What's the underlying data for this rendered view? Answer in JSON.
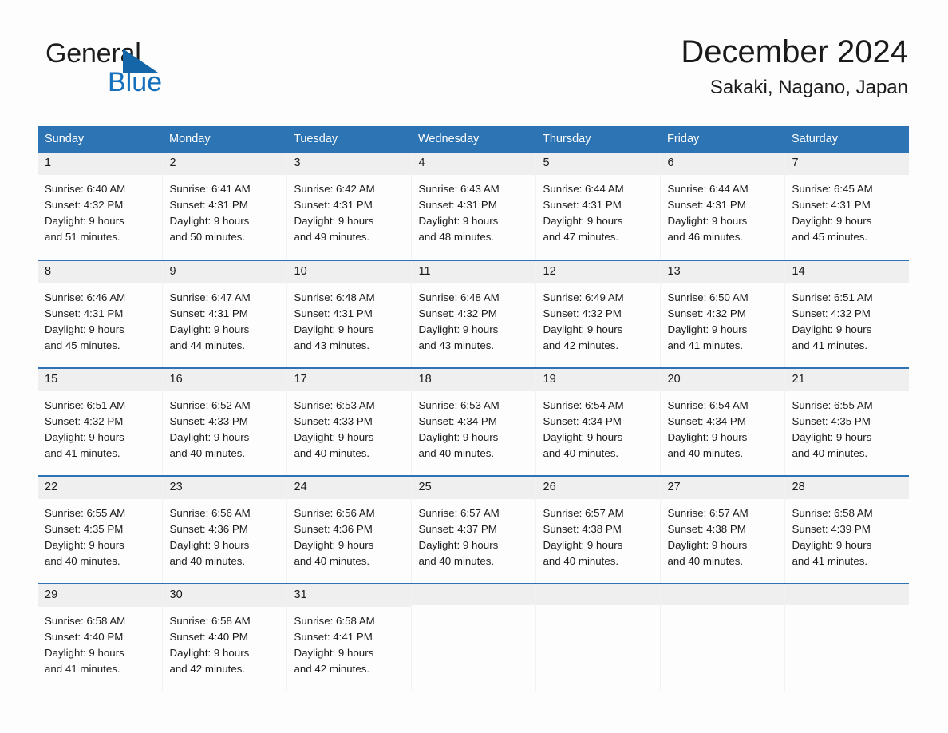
{
  "brand": {
    "name_top": "General",
    "name_bottom": "Blue",
    "triangle_icon": "blue-triangle-logo-mark",
    "accent_color": "#1570bd"
  },
  "header": {
    "title": "December 2024",
    "subtitle": "Sakaki, Nagano, Japan"
  },
  "theme": {
    "header_blue": "#2d74b4",
    "daynum_band": "#efefef",
    "page_background": "#fdfdfd",
    "text_color": "#1a1a1a"
  },
  "calendar": {
    "weekday_headers": [
      "Sunday",
      "Monday",
      "Tuesday",
      "Wednesday",
      "Thursday",
      "Friday",
      "Saturday"
    ],
    "labels": {
      "sunrise": "Sunrise:",
      "sunset": "Sunset:",
      "daylight": "Daylight:"
    },
    "weeks": [
      [
        {
          "day": "1",
          "sunrise": "Sunrise: 6:40 AM",
          "sunset": "Sunset: 4:32 PM",
          "daylight_line1": "Daylight: 9 hours",
          "daylight_line2": "and 51 minutes."
        },
        {
          "day": "2",
          "sunrise": "Sunrise: 6:41 AM",
          "sunset": "Sunset: 4:31 PM",
          "daylight_line1": "Daylight: 9 hours",
          "daylight_line2": "and 50 minutes."
        },
        {
          "day": "3",
          "sunrise": "Sunrise: 6:42 AM",
          "sunset": "Sunset: 4:31 PM",
          "daylight_line1": "Daylight: 9 hours",
          "daylight_line2": "and 49 minutes."
        },
        {
          "day": "4",
          "sunrise": "Sunrise: 6:43 AM",
          "sunset": "Sunset: 4:31 PM",
          "daylight_line1": "Daylight: 9 hours",
          "daylight_line2": "and 48 minutes."
        },
        {
          "day": "5",
          "sunrise": "Sunrise: 6:44 AM",
          "sunset": "Sunset: 4:31 PM",
          "daylight_line1": "Daylight: 9 hours",
          "daylight_line2": "and 47 minutes."
        },
        {
          "day": "6",
          "sunrise": "Sunrise: 6:44 AM",
          "sunset": "Sunset: 4:31 PM",
          "daylight_line1": "Daylight: 9 hours",
          "daylight_line2": "and 46 minutes."
        },
        {
          "day": "7",
          "sunrise": "Sunrise: 6:45 AM",
          "sunset": "Sunset: 4:31 PM",
          "daylight_line1": "Daylight: 9 hours",
          "daylight_line2": "and 45 minutes."
        }
      ],
      [
        {
          "day": "8",
          "sunrise": "Sunrise: 6:46 AM",
          "sunset": "Sunset: 4:31 PM",
          "daylight_line1": "Daylight: 9 hours",
          "daylight_line2": "and 45 minutes."
        },
        {
          "day": "9",
          "sunrise": "Sunrise: 6:47 AM",
          "sunset": "Sunset: 4:31 PM",
          "daylight_line1": "Daylight: 9 hours",
          "daylight_line2": "and 44 minutes."
        },
        {
          "day": "10",
          "sunrise": "Sunrise: 6:48 AM",
          "sunset": "Sunset: 4:31 PM",
          "daylight_line1": "Daylight: 9 hours",
          "daylight_line2": "and 43 minutes."
        },
        {
          "day": "11",
          "sunrise": "Sunrise: 6:48 AM",
          "sunset": "Sunset: 4:32 PM",
          "daylight_line1": "Daylight: 9 hours",
          "daylight_line2": "and 43 minutes."
        },
        {
          "day": "12",
          "sunrise": "Sunrise: 6:49 AM",
          "sunset": "Sunset: 4:32 PM",
          "daylight_line1": "Daylight: 9 hours",
          "daylight_line2": "and 42 minutes."
        },
        {
          "day": "13",
          "sunrise": "Sunrise: 6:50 AM",
          "sunset": "Sunset: 4:32 PM",
          "daylight_line1": "Daylight: 9 hours",
          "daylight_line2": "and 41 minutes."
        },
        {
          "day": "14",
          "sunrise": "Sunrise: 6:51 AM",
          "sunset": "Sunset: 4:32 PM",
          "daylight_line1": "Daylight: 9 hours",
          "daylight_line2": "and 41 minutes."
        }
      ],
      [
        {
          "day": "15",
          "sunrise": "Sunrise: 6:51 AM",
          "sunset": "Sunset: 4:32 PM",
          "daylight_line1": "Daylight: 9 hours",
          "daylight_line2": "and 41 minutes."
        },
        {
          "day": "16",
          "sunrise": "Sunrise: 6:52 AM",
          "sunset": "Sunset: 4:33 PM",
          "daylight_line1": "Daylight: 9 hours",
          "daylight_line2": "and 40 minutes."
        },
        {
          "day": "17",
          "sunrise": "Sunrise: 6:53 AM",
          "sunset": "Sunset: 4:33 PM",
          "daylight_line1": "Daylight: 9 hours",
          "daylight_line2": "and 40 minutes."
        },
        {
          "day": "18",
          "sunrise": "Sunrise: 6:53 AM",
          "sunset": "Sunset: 4:34 PM",
          "daylight_line1": "Daylight: 9 hours",
          "daylight_line2": "and 40 minutes."
        },
        {
          "day": "19",
          "sunrise": "Sunrise: 6:54 AM",
          "sunset": "Sunset: 4:34 PM",
          "daylight_line1": "Daylight: 9 hours",
          "daylight_line2": "and 40 minutes."
        },
        {
          "day": "20",
          "sunrise": "Sunrise: 6:54 AM",
          "sunset": "Sunset: 4:34 PM",
          "daylight_line1": "Daylight: 9 hours",
          "daylight_line2": "and 40 minutes."
        },
        {
          "day": "21",
          "sunrise": "Sunrise: 6:55 AM",
          "sunset": "Sunset: 4:35 PM",
          "daylight_line1": "Daylight: 9 hours",
          "daylight_line2": "and 40 minutes."
        }
      ],
      [
        {
          "day": "22",
          "sunrise": "Sunrise: 6:55 AM",
          "sunset": "Sunset: 4:35 PM",
          "daylight_line1": "Daylight: 9 hours",
          "daylight_line2": "and 40 minutes."
        },
        {
          "day": "23",
          "sunrise": "Sunrise: 6:56 AM",
          "sunset": "Sunset: 4:36 PM",
          "daylight_line1": "Daylight: 9 hours",
          "daylight_line2": "and 40 minutes."
        },
        {
          "day": "24",
          "sunrise": "Sunrise: 6:56 AM",
          "sunset": "Sunset: 4:36 PM",
          "daylight_line1": "Daylight: 9 hours",
          "daylight_line2": "and 40 minutes."
        },
        {
          "day": "25",
          "sunrise": "Sunrise: 6:57 AM",
          "sunset": "Sunset: 4:37 PM",
          "daylight_line1": "Daylight: 9 hours",
          "daylight_line2": "and 40 minutes."
        },
        {
          "day": "26",
          "sunrise": "Sunrise: 6:57 AM",
          "sunset": "Sunset: 4:38 PM",
          "daylight_line1": "Daylight: 9 hours",
          "daylight_line2": "and 40 minutes."
        },
        {
          "day": "27",
          "sunrise": "Sunrise: 6:57 AM",
          "sunset": "Sunset: 4:38 PM",
          "daylight_line1": "Daylight: 9 hours",
          "daylight_line2": "and 40 minutes."
        },
        {
          "day": "28",
          "sunrise": "Sunrise: 6:58 AM",
          "sunset": "Sunset: 4:39 PM",
          "daylight_line1": "Daylight: 9 hours",
          "daylight_line2": "and 41 minutes."
        }
      ],
      [
        {
          "day": "29",
          "sunrise": "Sunrise: 6:58 AM",
          "sunset": "Sunset: 4:40 PM",
          "daylight_line1": "Daylight: 9 hours",
          "daylight_line2": "and 41 minutes."
        },
        {
          "day": "30",
          "sunrise": "Sunrise: 6:58 AM",
          "sunset": "Sunset: 4:40 PM",
          "daylight_line1": "Daylight: 9 hours",
          "daylight_line2": "and 42 minutes."
        },
        {
          "day": "31",
          "sunrise": "Sunrise: 6:58 AM",
          "sunset": "Sunset: 4:41 PM",
          "daylight_line1": "Daylight: 9 hours",
          "daylight_line2": "and 42 minutes."
        },
        {
          "day": "",
          "sunrise": "",
          "sunset": "",
          "daylight_line1": "",
          "daylight_line2": ""
        },
        {
          "day": "",
          "sunrise": "",
          "sunset": "",
          "daylight_line1": "",
          "daylight_line2": ""
        },
        {
          "day": "",
          "sunrise": "",
          "sunset": "",
          "daylight_line1": "",
          "daylight_line2": ""
        },
        {
          "day": "",
          "sunrise": "",
          "sunset": "",
          "daylight_line1": "",
          "daylight_line2": ""
        }
      ]
    ]
  }
}
